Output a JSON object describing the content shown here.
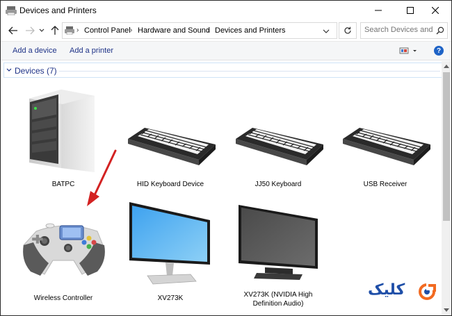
{
  "window": {
    "title": "Devices and Printers"
  },
  "address": {
    "crumbs": [
      "Control Panel",
      "Hardware and Sound",
      "Devices and Printers"
    ]
  },
  "search": {
    "placeholder": "Search Devices and ..."
  },
  "commands": {
    "add_device": "Add a device",
    "add_printer": "Add a printer"
  },
  "help": {
    "glyph": "?"
  },
  "group": {
    "title": "Devices (7)"
  },
  "devices": [
    {
      "label": "BATPC",
      "icon": "computer-tower-icon"
    },
    {
      "label": "HID Keyboard Device",
      "icon": "keyboard-icon"
    },
    {
      "label": "JJ50 Keyboard",
      "icon": "keyboard-icon"
    },
    {
      "label": "USB Receiver",
      "icon": "keyboard-icon"
    },
    {
      "label": "Wireless Controller",
      "icon": "gamepad-icon"
    },
    {
      "label": "XV273K",
      "icon": "monitor-icon"
    },
    {
      "label": "XV273K (NVIDIA High",
      "label2": "Definition Audio)",
      "icon": "monitor-icon"
    }
  ],
  "watermark": {
    "text": "کلیک"
  },
  "colors": {
    "link_blue": "#1e3287",
    "arrow_red": "#d32222",
    "help_blue": "#1e63c6",
    "watermark_blue": "#1f4fa8",
    "watermark_orange": "#f26a21"
  }
}
